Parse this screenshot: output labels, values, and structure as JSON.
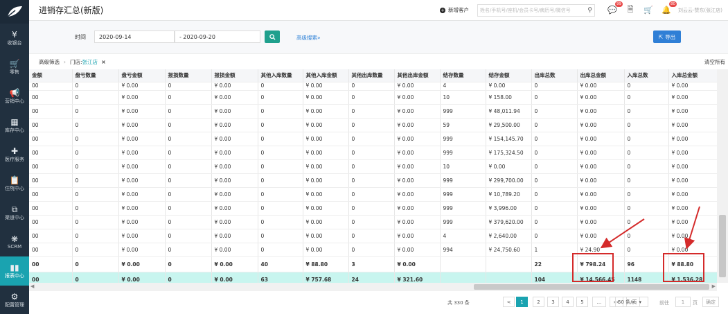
{
  "page_title": "进销存汇总(新版)",
  "sidebar": [
    {
      "label": "收银台",
      "icon": "yen-icon",
      "glyph": "¥"
    },
    {
      "label": "零售",
      "icon": "cart-icon",
      "glyph": "🛒"
    },
    {
      "label": "营销中心",
      "icon": "megaphone-icon",
      "glyph": "📢"
    },
    {
      "label": "库存中心",
      "icon": "grid-icon",
      "glyph": "▦"
    },
    {
      "label": "医疗服务",
      "icon": "medkit-icon",
      "glyph": "✚"
    },
    {
      "label": "住院中心",
      "icon": "clipboard-icon",
      "glyph": "📋"
    },
    {
      "label": "渠道中心",
      "icon": "org-chart-icon",
      "glyph": "⧉"
    },
    {
      "label": "SCRM",
      "icon": "users-icon",
      "glyph": "❋"
    },
    {
      "label": "报表中心",
      "icon": "bar-chart-icon",
      "glyph": "▮▮"
    },
    {
      "label": "配置管理",
      "icon": "gear-icon",
      "glyph": "⚙"
    }
  ],
  "topbar": {
    "new_customer": "新增客户",
    "search_placeholder": "姓名/手机号/座机/会员卡号/病历号/微信号",
    "badge_chat": "99",
    "badge_notify": "80",
    "user": "刘云云-赞东(张江店)"
  },
  "filter": {
    "time_label": "时间",
    "date_start": "2020-09-14",
    "date_end": "- 2020-09-20",
    "advanced": "高级搜索»",
    "export": "导出"
  },
  "crumb": {
    "label": "高级筛选",
    "sep": "›",
    "chip_key": "门店:",
    "chip_value": "张江店",
    "chip_close": "×",
    "clear_all": "清空所有"
  },
  "table": {
    "columns": [
      "金额",
      "盘亏数量",
      "盘亏金额",
      "报损数量",
      "报损金额",
      "其他入库数量",
      "其他入库金额",
      "其他出库数量",
      "其他出库金额",
      "结存数量",
      "结存金额",
      "出库总数",
      "出库总金额",
      "入库总数",
      "入库总金额"
    ],
    "partial_row": [
      "00",
      "0",
      "¥ 0.00",
      "0",
      "¥ 0.00",
      "0",
      "¥ 0.00",
      "0",
      "¥ 0.00",
      "4",
      "¥ 0.00",
      "0",
      "¥ 0.00",
      "0",
      "¥ 0.00"
    ],
    "rows": [
      [
        "00",
        "0",
        "¥ 0.00",
        "0",
        "¥ 0.00",
        "0",
        "¥ 0.00",
        "0",
        "¥ 0.00",
        "10",
        "¥ 158.00",
        "0",
        "¥ 0.00",
        "0",
        "¥ 0.00"
      ],
      [
        "00",
        "0",
        "¥ 0.00",
        "0",
        "¥ 0.00",
        "0",
        "¥ 0.00",
        "0",
        "¥ 0.00",
        "999",
        "¥ 48,011.94",
        "0",
        "¥ 0.00",
        "0",
        "¥ 0.00"
      ],
      [
        "00",
        "0",
        "¥ 0.00",
        "0",
        "¥ 0.00",
        "0",
        "¥ 0.00",
        "0",
        "¥ 0.00",
        "59",
        "¥ 29,500.00",
        "0",
        "¥ 0.00",
        "0",
        "¥ 0.00"
      ],
      [
        "00",
        "0",
        "¥ 0.00",
        "0",
        "¥ 0.00",
        "0",
        "¥ 0.00",
        "0",
        "¥ 0.00",
        "999",
        "¥ 154,145.70",
        "0",
        "¥ 0.00",
        "0",
        "¥ 0.00"
      ],
      [
        "00",
        "0",
        "¥ 0.00",
        "0",
        "¥ 0.00",
        "0",
        "¥ 0.00",
        "0",
        "¥ 0.00",
        "999",
        "¥ 175,324.50",
        "0",
        "¥ 0.00",
        "0",
        "¥ 0.00"
      ],
      [
        "00",
        "0",
        "¥ 0.00",
        "0",
        "¥ 0.00",
        "0",
        "¥ 0.00",
        "0",
        "¥ 0.00",
        "10",
        "¥ 0.00",
        "0",
        "¥ 0.00",
        "0",
        "¥ 0.00"
      ],
      [
        "00",
        "0",
        "¥ 0.00",
        "0",
        "¥ 0.00",
        "0",
        "¥ 0.00",
        "0",
        "¥ 0.00",
        "999",
        "¥ 299,700.00",
        "0",
        "¥ 0.00",
        "0",
        "¥ 0.00"
      ],
      [
        "00",
        "0",
        "¥ 0.00",
        "0",
        "¥ 0.00",
        "0",
        "¥ 0.00",
        "0",
        "¥ 0.00",
        "999",
        "¥ 10,789.20",
        "0",
        "¥ 0.00",
        "0",
        "¥ 0.00"
      ],
      [
        "00",
        "0",
        "¥ 0.00",
        "0",
        "¥ 0.00",
        "0",
        "¥ 0.00",
        "0",
        "¥ 0.00",
        "999",
        "¥ 3,996.00",
        "0",
        "¥ 0.00",
        "0",
        "¥ 0.00"
      ],
      [
        "00",
        "0",
        "¥ 0.00",
        "0",
        "¥ 0.00",
        "0",
        "¥ 0.00",
        "0",
        "¥ 0.00",
        "999",
        "¥ 379,620.00",
        "0",
        "¥ 0.00",
        "0",
        "¥ 0.00"
      ],
      [
        "00",
        "0",
        "¥ 0.00",
        "0",
        "¥ 0.00",
        "0",
        "¥ 0.00",
        "0",
        "¥ 0.00",
        "4",
        "¥ 2,640.00",
        "0",
        "¥ 0.00",
        "0",
        "¥ 0.00"
      ],
      [
        "00",
        "0",
        "¥ 0.00",
        "0",
        "¥ 0.00",
        "0",
        "¥ 0.00",
        "0",
        "¥ 0.00",
        "994",
        "¥ 24,750.60",
        "1",
        "¥ 24.90",
        "0",
        "¥ 0.00"
      ]
    ],
    "sum_row": [
      "00",
      "0",
      "¥ 0.00",
      "0",
      "¥ 0.00",
      "40",
      "¥ 88.80",
      "3",
      "¥ 0.00",
      "",
      "",
      "22",
      "¥ 798.24",
      "96",
      "¥ 88.80"
    ],
    "total_row": [
      "00",
      "0",
      "¥ 0.00",
      "0",
      "¥ 0.00",
      "63",
      "¥ 757.68",
      "24",
      "¥ 321.60",
      "",
      "",
      "104",
      "¥ 14,566.45",
      "1148",
      "¥ 1,536.28"
    ]
  },
  "pager": {
    "total": "共 330 条",
    "prev": "<",
    "pages": [
      "1",
      "2",
      "3",
      "4",
      "5",
      "...",
      "»»",
      ">"
    ],
    "page_size": "50 条/页",
    "goto": "前往",
    "input": "1",
    "page_unit": "页",
    "confirm": "确定"
  },
  "colors": {
    "sidebar": "#21303f",
    "accent": "#1aa3b0",
    "total_row": "#c8f5ef",
    "callout": "#d42a2a"
  }
}
